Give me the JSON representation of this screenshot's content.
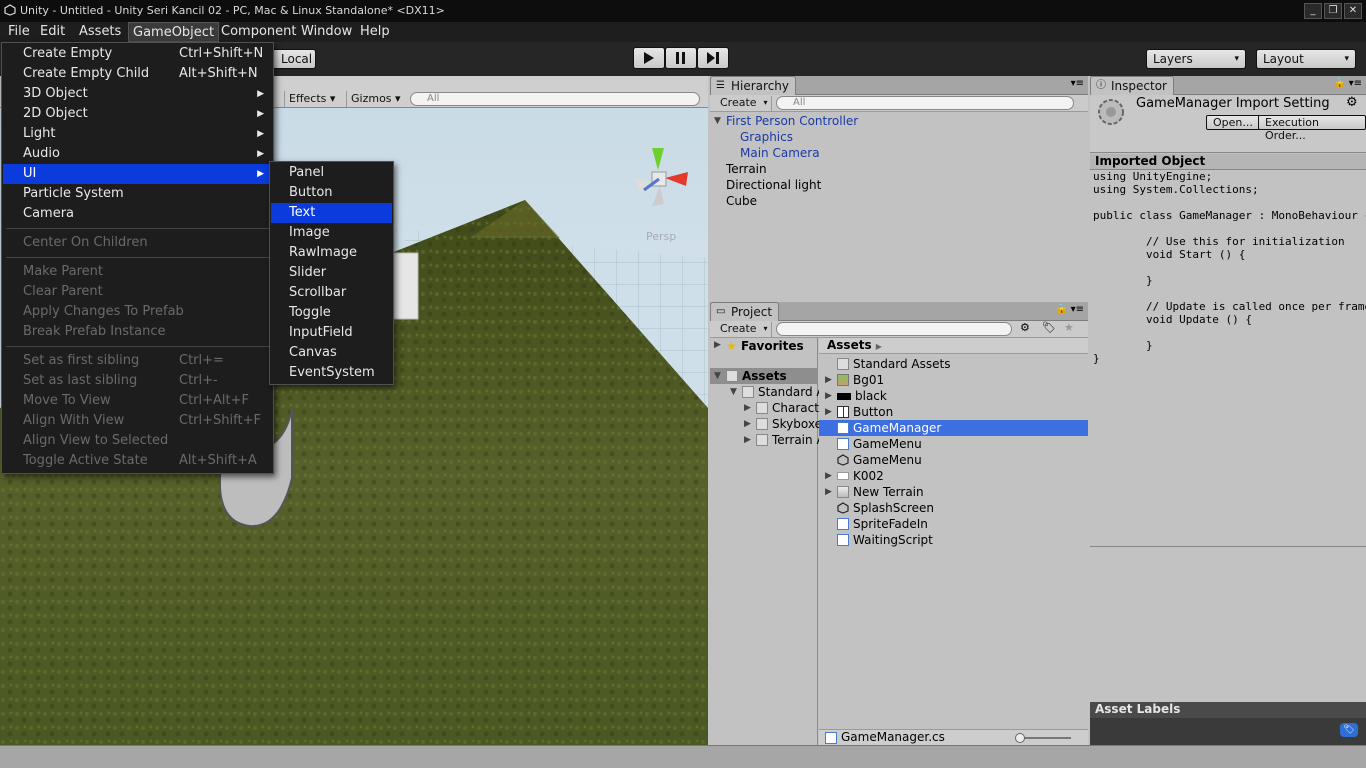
{
  "window": {
    "title": "Unity - Untitled - Unity Seri Kancil 02 - PC, Mac & Linux Standalone* <DX11>",
    "controls": [
      "_",
      "❐",
      "✕"
    ]
  },
  "menubar": [
    "File",
    "Edit",
    "Assets",
    "GameObject",
    "Component",
    "Window",
    "Help"
  ],
  "toolbar": {
    "local_label": "Local",
    "layers_label": "Layers",
    "layout_label": "Layout"
  },
  "scene": {
    "effects_label": "Effects",
    "gizmos_label": "Gizmos",
    "search_placeholder": "All",
    "persp_label": "Persp"
  },
  "gameobject_menu": {
    "items": [
      {
        "label": "Create Empty",
        "shortcut": "Ctrl+Shift+N"
      },
      {
        "label": "Create Empty Child",
        "shortcut": "Alt+Shift+N"
      },
      {
        "label": "3D Object"
      },
      {
        "label": "2D Object"
      },
      {
        "label": "Light"
      },
      {
        "label": "Audio"
      },
      {
        "label": "UI"
      },
      {
        "label": "Particle System"
      },
      {
        "label": "Camera"
      },
      {
        "label": "Center On Children"
      },
      {
        "label": "Make Parent"
      },
      {
        "label": "Clear Parent"
      },
      {
        "label": "Apply Changes To Prefab"
      },
      {
        "label": "Break Prefab Instance"
      },
      {
        "label": "Set as first sibling",
        "shortcut": "Ctrl+="
      },
      {
        "label": "Set as last sibling",
        "shortcut": "Ctrl+-"
      },
      {
        "label": "Move To View",
        "shortcut": "Ctrl+Alt+F"
      },
      {
        "label": "Align With View",
        "shortcut": "Ctrl+Shift+F"
      },
      {
        "label": "Align View to Selected"
      },
      {
        "label": "Toggle Active State",
        "shortcut": "Alt+Shift+A"
      }
    ]
  },
  "ui_submenu": {
    "items": [
      "Panel",
      "Button",
      "Text",
      "Image",
      "RawImage",
      "Slider",
      "Scrollbar",
      "Toggle",
      "InputField",
      "Canvas",
      "EventSystem"
    ]
  },
  "hierarchy": {
    "tab_label": "Hierarchy",
    "create_label": "Create",
    "search_placeholder": "All",
    "items": [
      "First Person Controller",
      "Graphics",
      "Main Camera",
      "Terrain",
      "Directional light",
      "Cube"
    ]
  },
  "project": {
    "tab_label": "Project",
    "create_label": "Create",
    "favorites_label": "Favorites",
    "assets_label": "Assets",
    "tree": [
      "Standard A",
      "Characte",
      "Skyboxe",
      "Terrain A"
    ],
    "breadcrumb": "Assets",
    "files": [
      "Standard Assets",
      "Bg01",
      "black",
      "Button",
      "GameManager",
      "GameMenu",
      "GameMenu",
      "K002",
      "New Terrain",
      "SplashScreen",
      "SpriteFadeIn",
      "WaitingScript"
    ],
    "footer_file": "GameManager.cs"
  },
  "inspector": {
    "tab_label": "Inspector",
    "title": "GameManager Import Setting",
    "open_label": "Open...",
    "exec_label": "Execution Order...",
    "section_label": "Imported Object",
    "code_lines": [
      "using UnityEngine;",
      "using System.Collections;",
      "",
      "public class GameManager : MonoBehaviour {",
      "",
      "        // Use this for initialization",
      "        void Start () {",
      "",
      "        }",
      "",
      "        // Update is called once per frame",
      "        void Update () {",
      "",
      "        }",
      "}"
    ],
    "asset_labels": "Asset Labels"
  }
}
